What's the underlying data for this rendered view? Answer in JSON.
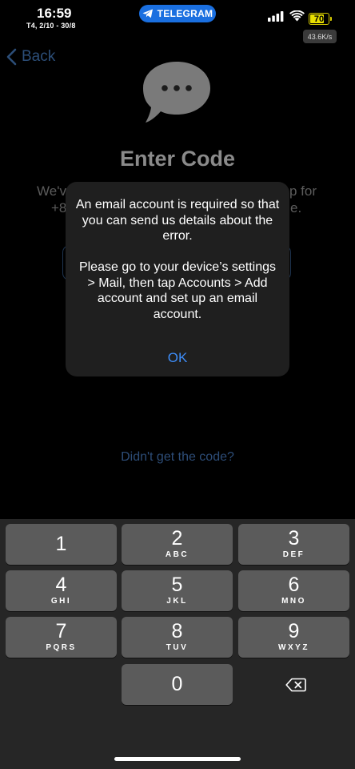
{
  "status_bar": {
    "time": "16:59",
    "date": "T4, 2/10 - 30/8",
    "app_pill": "TELEGRAM",
    "battery": "70",
    "net_speed": "43.6K/s"
  },
  "nav": {
    "back_label": "Back"
  },
  "page": {
    "title": "Enter Code",
    "desc_line1_left": "We'v",
    "desc_line1_right": "p for",
    "desc_line2_left": "+8",
    "desc_line2_right": "e.",
    "resend_link": "Didn't get the code?"
  },
  "alert": {
    "message_1": "An email account is required so that you can send us details about the error.",
    "message_2": "Please go to your device’s settings > Mail, then tap Accounts > Add account and set up an email account.",
    "ok_label": "OK"
  },
  "keypad": {
    "keys": [
      {
        "num": "1",
        "letters": ""
      },
      {
        "num": "2",
        "letters": "ABC"
      },
      {
        "num": "3",
        "letters": "DEF"
      },
      {
        "num": "4",
        "letters": "GHI"
      },
      {
        "num": "5",
        "letters": "JKL"
      },
      {
        "num": "6",
        "letters": "MNO"
      },
      {
        "num": "7",
        "letters": "PQRS"
      },
      {
        "num": "8",
        "letters": "TUV"
      },
      {
        "num": "9",
        "letters": "WXYZ"
      },
      {
        "num": "0",
        "letters": ""
      }
    ]
  },
  "colors": {
    "accent": "#3d8cf7",
    "battery": "#e8df00",
    "telegram_pill": "#1a6fe0"
  }
}
